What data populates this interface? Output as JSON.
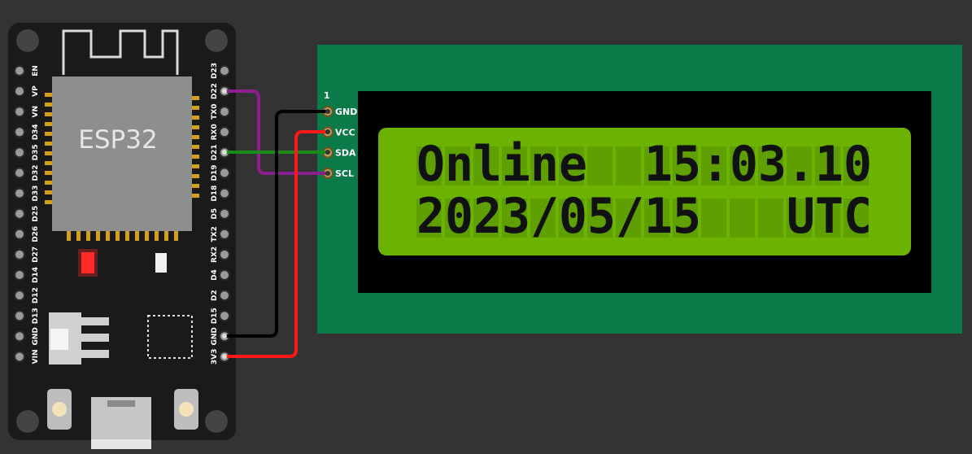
{
  "board": {
    "chip_label": "ESP32",
    "left_pins": [
      "EN",
      "VP",
      "VN",
      "D34",
      "D35",
      "D32",
      "D33",
      "D25",
      "D26",
      "D27",
      "D14",
      "D12",
      "D13",
      "GND",
      "VIN"
    ],
    "right_pins": [
      "D23",
      "D22",
      "TX0",
      "RX0",
      "D21",
      "D19",
      "D18",
      "D5",
      "TX2",
      "RX2",
      "D4",
      "D2",
      "D15",
      "GND",
      "3V3"
    ]
  },
  "lcd": {
    "pin_one_label": "1",
    "pins": [
      "GND",
      "VCC",
      "SDA",
      "SCL"
    ],
    "line1": "Online  15:03.10",
    "line2": "2023/05/15   UTC",
    "colors": {
      "frame": "#0b7a49",
      "bezel": "#000000",
      "screen": "#6cb200"
    }
  },
  "wires": [
    {
      "from": "D22",
      "to": "SCL",
      "color": "#8b1f8b"
    },
    {
      "from": "D21",
      "to": "SDA",
      "color": "#1a8a1a"
    },
    {
      "from": "GND",
      "to": "GND",
      "color": "#000000"
    },
    {
      "from": "3V3",
      "to": "VCC",
      "color": "#ff1a1a"
    }
  ]
}
